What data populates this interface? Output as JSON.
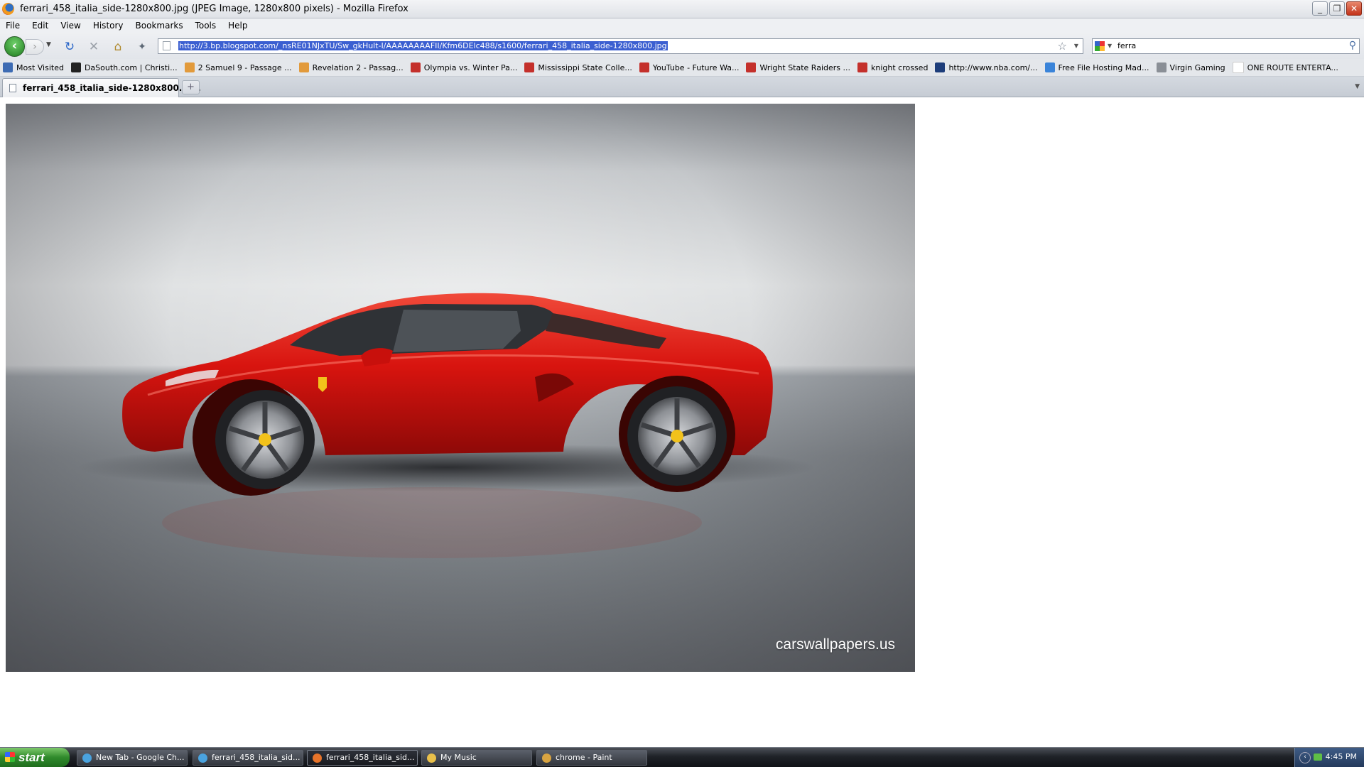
{
  "window": {
    "title": "ferrari_458_italia_side-1280x800.jpg (JPEG Image, 1280x800 pixels) - Mozilla Firefox",
    "buttons": {
      "minimize": "_",
      "restore": "❐",
      "close": "✕"
    }
  },
  "menu": [
    "File",
    "Edit",
    "View",
    "History",
    "Bookmarks",
    "Tools",
    "Help"
  ],
  "nav": {
    "back_icon": "back-arrow-icon",
    "forward_icon": "forward-arrow-icon",
    "url": "http://3.bp.blogspot.com/_nsRE01NJxTU/Sw_gkHult-I/AAAAAAAAFII/Kfm6DElc488/s1600/ferrari_458_italia_side-1280x800.jpg",
    "search_value": "ferra"
  },
  "bookmarks": [
    {
      "label": "Most Visited",
      "color": "#3d6bb3"
    },
    {
      "label": "DaSouth.com | Christi...",
      "color": "#222222"
    },
    {
      "label": "2 Samuel 9 - Passage ...",
      "color": "#e29a3b"
    },
    {
      "label": "Revelation 2 - Passag...",
      "color": "#e29a3b"
    },
    {
      "label": "Olympia vs. Winter Pa...",
      "color": "#c4302b"
    },
    {
      "label": "Mississippi State Colle...",
      "color": "#c4302b"
    },
    {
      "label": "YouTube - Future Wa...",
      "color": "#c4302b"
    },
    {
      "label": "Wright State Raiders ...",
      "color": "#c4302b"
    },
    {
      "label": "knight crossed",
      "color": "#c4302b"
    },
    {
      "label": "http://www.nba.com/...",
      "color": "#1d3d7a"
    },
    {
      "label": "Free File Hosting Mad...",
      "color": "#3a84d9"
    },
    {
      "label": "Virgin Gaming",
      "color": "#8a8f96"
    },
    {
      "label": "ONE ROUTE ENTERTA...",
      "color": "#ffffff"
    }
  ],
  "tabs": [
    {
      "label": "ferrari_458_italia_side-1280x800.jp..."
    }
  ],
  "image": {
    "watermark": "carswallpapers.us",
    "car_color": "#d8140f"
  },
  "taskbar": {
    "start": "start",
    "tasks": [
      {
        "label": "New Tab - Google Ch...",
        "color": "#4aa3df",
        "active": false
      },
      {
        "label": "ferrari_458_italia_sid...",
        "color": "#4aa3df",
        "active": false
      },
      {
        "label": "ferrari_458_italia_sid...",
        "color": "#e8742a",
        "active": true
      },
      {
        "label": "My Music",
        "color": "#e9c04a",
        "active": false
      },
      {
        "label": "chrome - Paint",
        "color": "#d9a441",
        "active": false
      }
    ],
    "clock": "4:45 PM"
  }
}
